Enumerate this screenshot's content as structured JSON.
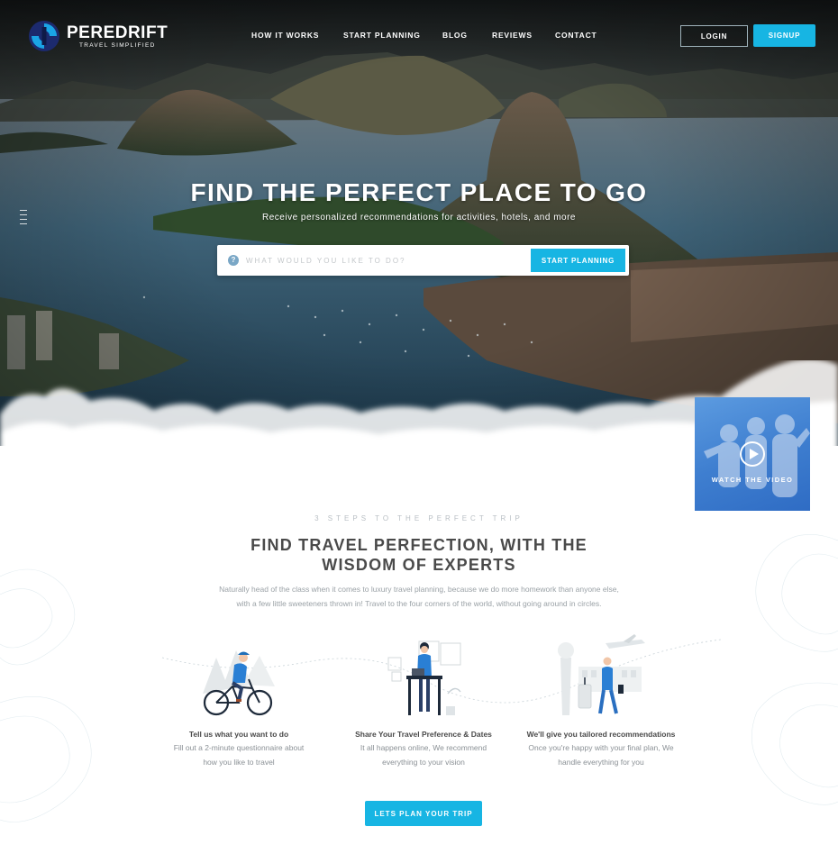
{
  "brand": {
    "name": "PEREDRIFT",
    "tagline": "TRAVEL SIMPLIFIED",
    "accent": "#17b5e3"
  },
  "nav": {
    "items": [
      "HOW IT WORKS",
      "START PLANNING",
      "BLOG",
      "REVIEWS",
      "CONTACT"
    ],
    "login_label": "LOGIN",
    "signup_label": "SIGNUP"
  },
  "hero": {
    "title": "FIND THE PERFECT PLACE TO GO",
    "subtitle": "Receive personalized recommendations for activities, hotels, and more",
    "search": {
      "placeholder": "WHAT WOULD YOU LIKE TO DO?",
      "icon": "question-icon",
      "button_label": "START PLANNING"
    }
  },
  "video": {
    "label": "WATCH THE VIDEO",
    "icon": "play-icon"
  },
  "steps_section": {
    "eyebrow": "3 STEPS TO THE PERFECT TRIP",
    "title_line1": "FIND TRAVEL PERFECTION, WITH THE",
    "title_line2": "WISDOM OF EXPERTS",
    "intro_line1": "Naturally head of the class when it comes to luxury travel planning, because we do more homework than anyone else,",
    "intro_line2": "with a few little sweeteners thrown in! Travel to the four corners of the world, without going around in circles.",
    "steps": [
      {
        "icon": "cyclist-illustration",
        "title": "Tell us what you want to do",
        "desc_line1": "Fill out a 2-minute questionnaire about",
        "desc_line2": "how you like to travel"
      },
      {
        "icon": "desk-worker-illustration",
        "title": "Share Your Travel Preference & Dates",
        "desc_line1": "It all happens online, We recommend",
        "desc_line2": "everything to your vision"
      },
      {
        "icon": "traveler-airport-illustration",
        "title": "We'll give you tailored recommendations",
        "desc_line1": "Once you're happy with your final plan, We",
        "desc_line2": "handle everything for you"
      }
    ],
    "cta_label": "LETS PLAN YOUR TRIP"
  }
}
